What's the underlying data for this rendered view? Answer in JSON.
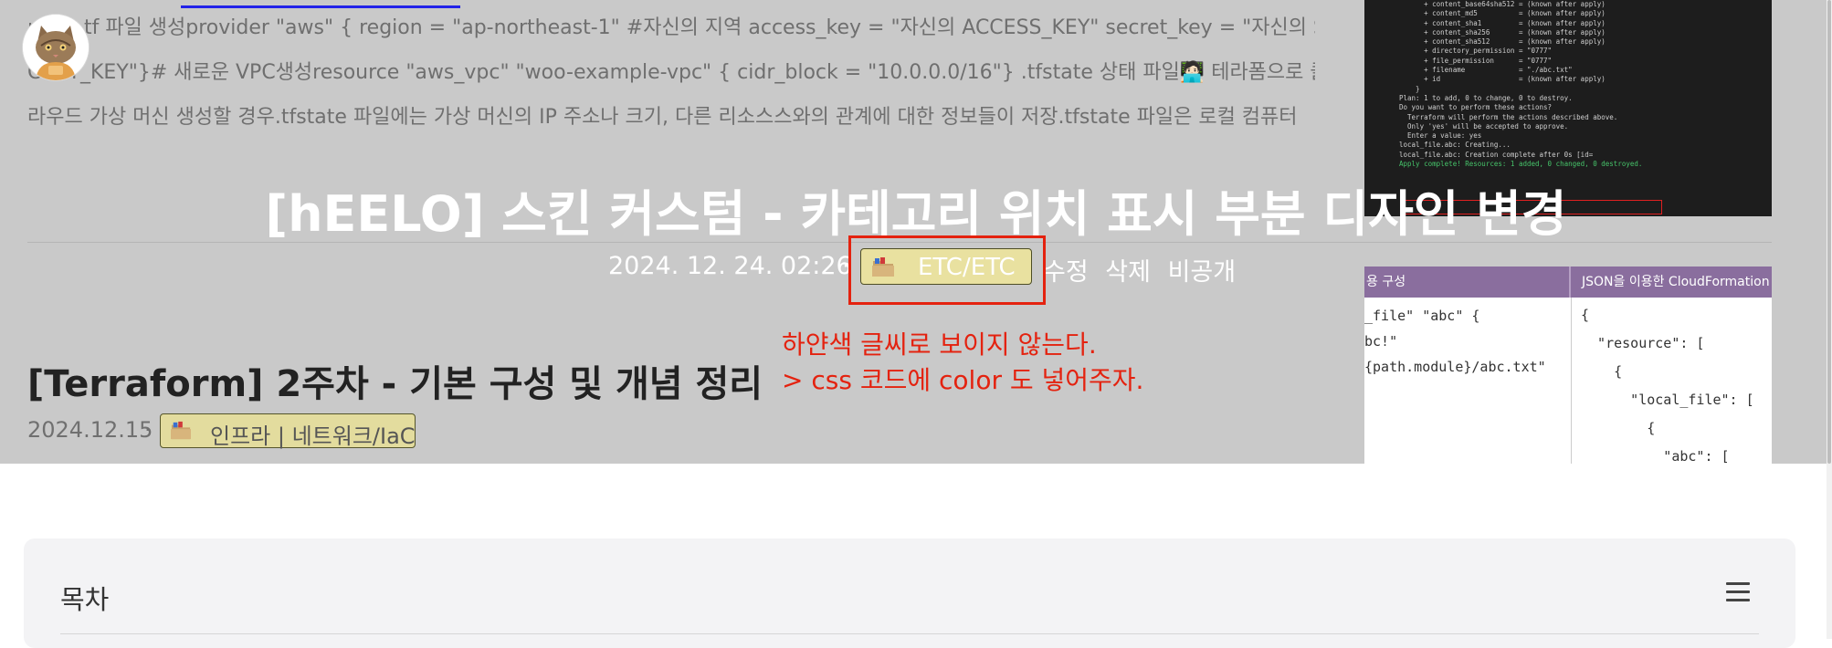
{
  "background_text": {
    "lines": [
      "main.tf 파일 생성provider \"aws\" { region = \"ap-northeast-1\" #자신의 지역 access_key = \"자신의 ACCESS_KEY\" secret_key = \"자신의 SE",
      "CRET_KEY\"}# 새로운 VPC생성resource \"aws_vpc\" \"woo-example-vpc\" { cidr_block = \"10.0.0.0/16\"} .tfstate 상태 파일🧑🏻‍💻 테라폼으로 클",
      "라우드 가상 머신 생성할 경우.tfstate 파일에는 가상 머신의 IP 주소나 크기, 다른 리소스스와의 관계에 대한 정보들이 저장.tfstate 파일은 로컬 컴퓨터"
    ]
  },
  "terminal": {
    "lines": [
      "      + content_base64sha512 = (known after apply)",
      "      + content_md5          = (known after apply)",
      "      + content_sha1         = (known after apply)",
      "      + content_sha256       = (known after apply)",
      "      + content_sha512       = (known after apply)",
      "      + directory_permission = \"0777\"",
      "      + file_permission      = \"0777\"",
      "      + filename             = \"./abc.txt\"",
      "      + id                   = (known after apply)",
      "    }",
      "",
      "Plan: 1 to add, 0 to change, 0 to destroy.",
      "",
      "Do you want to perform these actions?",
      "  Terraform will perform the actions described above.",
      "  Only 'yes' will be accepted to approve.",
      "",
      "  Enter a value: yes",
      "",
      "local_file.abc: Creating...",
      "local_file.abc: Creation complete after 0s [id=",
      "",
      "Apply complete! Resources: 1 added, 0 changed, 0 destroyed."
    ]
  },
  "compare": {
    "header_left": "용 구성",
    "header_right": "JSON을 이용한 CloudFormation",
    "left_code": "_file\" \"abc\" {\nbc!\"\n{path.module}/abc.txt\"",
    "right_code": "{\n  \"resource\": [\n    {\n      \"local_file\": [\n        {\n          \"abc\": [\n            {\n              \"content\": \""
  },
  "post": {
    "title": "[hEELO] 스킨 커스텀 - 카테고리 위치 표시 부분 디자인 변경",
    "date": "2024. 12. 24. 02:26",
    "separator": "·",
    "category": "ETC/ETC",
    "actions": [
      "수정",
      "삭제",
      "비공개"
    ]
  },
  "annotation": {
    "line1": "하얀색 글씨로 보이지 않는다.",
    "line2": "> css 코드에 color 도 넣어주자."
  },
  "post2": {
    "title": "[Terraform] 2주차 - 기본 구성 및 개념 정리",
    "date": "2024.12.15",
    "separator": "·",
    "category": "인프라 | 네트워크/IaC"
  },
  "toc": {
    "title": "목차"
  },
  "colors": {
    "annotation_red": "#e4220f",
    "badge_yellow": "#e9e1a0",
    "overlay_gray": "#c9c9c9",
    "toc_bg": "#f3f3f5"
  },
  "icons": {
    "folder": "folder-icon",
    "menu": "hamburger-menu-icon",
    "avatar": "cat-avatar"
  }
}
